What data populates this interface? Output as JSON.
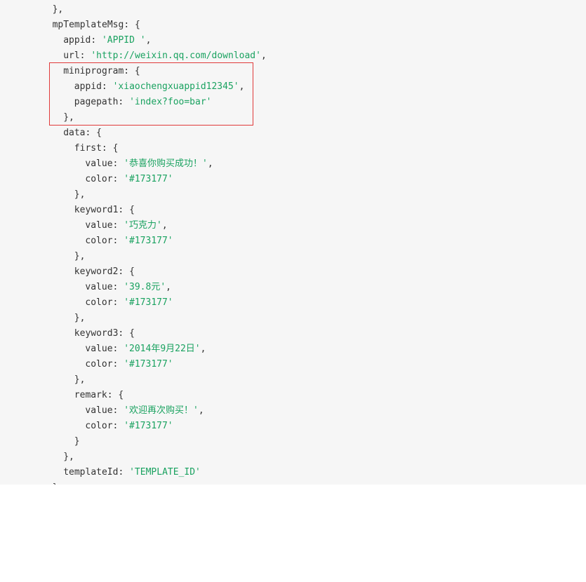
{
  "code_lines": [
    {
      "indent": 1,
      "tokens": [
        {
          "t": "p",
          "v": "},"
        }
      ]
    },
    {
      "indent": 1,
      "tokens": [
        {
          "t": "p",
          "v": "mpTemplateMsg: {"
        }
      ]
    },
    {
      "indent": 2,
      "tokens": [
        {
          "t": "p",
          "v": "appid: "
        },
        {
          "t": "s",
          "v": "'APPID '"
        },
        {
          "t": "p",
          "v": ","
        }
      ]
    },
    {
      "indent": 2,
      "tokens": [
        {
          "t": "p",
          "v": "url: "
        },
        {
          "t": "s",
          "v": "'http://weixin.qq.com/download'"
        },
        {
          "t": "p",
          "v": ","
        }
      ]
    },
    {
      "indent": 2,
      "tokens": [
        {
          "t": "p",
          "v": "miniprogram: {"
        }
      ]
    },
    {
      "indent": 3,
      "tokens": [
        {
          "t": "p",
          "v": "appid: "
        },
        {
          "t": "s",
          "v": "'xiaochengxuappid12345'"
        },
        {
          "t": "p",
          "v": ","
        }
      ]
    },
    {
      "indent": 3,
      "tokens": [
        {
          "t": "p",
          "v": "pagepath: "
        },
        {
          "t": "s",
          "v": "'index?foo=bar'"
        }
      ]
    },
    {
      "indent": 2,
      "tokens": [
        {
          "t": "p",
          "v": "},"
        }
      ]
    },
    {
      "indent": 2,
      "tokens": [
        {
          "t": "p",
          "v": "data: {"
        }
      ]
    },
    {
      "indent": 3,
      "tokens": [
        {
          "t": "p",
          "v": "first: {"
        }
      ]
    },
    {
      "indent": 4,
      "tokens": [
        {
          "t": "p",
          "v": "value: "
        },
        {
          "t": "s",
          "v": "'恭喜你购买成功！'"
        },
        {
          "t": "p",
          "v": ","
        }
      ]
    },
    {
      "indent": 4,
      "tokens": [
        {
          "t": "p",
          "v": "color: "
        },
        {
          "t": "s",
          "v": "'#173177'"
        }
      ]
    },
    {
      "indent": 3,
      "tokens": [
        {
          "t": "p",
          "v": "},"
        }
      ]
    },
    {
      "indent": 3,
      "tokens": [
        {
          "t": "p",
          "v": "keyword1: {"
        }
      ]
    },
    {
      "indent": 4,
      "tokens": [
        {
          "t": "p",
          "v": "value: "
        },
        {
          "t": "s",
          "v": "'巧克力'"
        },
        {
          "t": "p",
          "v": ","
        }
      ]
    },
    {
      "indent": 4,
      "tokens": [
        {
          "t": "p",
          "v": "color: "
        },
        {
          "t": "s",
          "v": "'#173177'"
        }
      ]
    },
    {
      "indent": 3,
      "tokens": [
        {
          "t": "p",
          "v": "},"
        }
      ]
    },
    {
      "indent": 3,
      "tokens": [
        {
          "t": "p",
          "v": "keyword2: {"
        }
      ]
    },
    {
      "indent": 4,
      "tokens": [
        {
          "t": "p",
          "v": "value: "
        },
        {
          "t": "s",
          "v": "'39.8元'"
        },
        {
          "t": "p",
          "v": ","
        }
      ]
    },
    {
      "indent": 4,
      "tokens": [
        {
          "t": "p",
          "v": "color: "
        },
        {
          "t": "s",
          "v": "'#173177'"
        }
      ]
    },
    {
      "indent": 3,
      "tokens": [
        {
          "t": "p",
          "v": "},"
        }
      ]
    },
    {
      "indent": 3,
      "tokens": [
        {
          "t": "p",
          "v": "keyword3: {"
        }
      ]
    },
    {
      "indent": 4,
      "tokens": [
        {
          "t": "p",
          "v": "value: "
        },
        {
          "t": "s",
          "v": "'2014年9月22日'"
        },
        {
          "t": "p",
          "v": ","
        }
      ]
    },
    {
      "indent": 4,
      "tokens": [
        {
          "t": "p",
          "v": "color: "
        },
        {
          "t": "s",
          "v": "'#173177'"
        }
      ]
    },
    {
      "indent": 3,
      "tokens": [
        {
          "t": "p",
          "v": "},"
        }
      ]
    },
    {
      "indent": 3,
      "tokens": [
        {
          "t": "p",
          "v": "remark: {"
        }
      ]
    },
    {
      "indent": 4,
      "tokens": [
        {
          "t": "p",
          "v": "value: "
        },
        {
          "t": "s",
          "v": "'欢迎再次购买！'"
        },
        {
          "t": "p",
          "v": ","
        }
      ]
    },
    {
      "indent": 4,
      "tokens": [
        {
          "t": "p",
          "v": "color: "
        },
        {
          "t": "s",
          "v": "'#173177'"
        }
      ]
    },
    {
      "indent": 3,
      "tokens": [
        {
          "t": "p",
          "v": "}"
        }
      ]
    },
    {
      "indent": 2,
      "tokens": [
        {
          "t": "p",
          "v": "},"
        }
      ]
    },
    {
      "indent": 2,
      "tokens": [
        {
          "t": "p",
          "v": "templateId: "
        },
        {
          "t": "s",
          "v": "'TEMPLATE_ID'"
        }
      ]
    },
    {
      "indent": 1,
      "tokens": [
        {
          "t": "p",
          "v": "}"
        }
      ]
    }
  ],
  "colors": {
    "background": "#f6f6f6",
    "text": "#333333",
    "string": "#1aa260",
    "highlight_border": "#e03a3a"
  }
}
